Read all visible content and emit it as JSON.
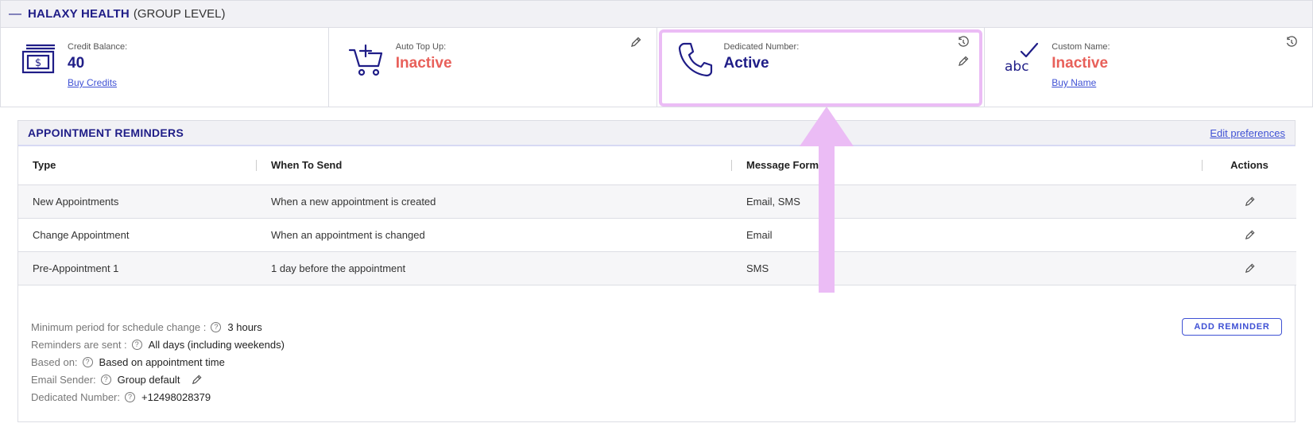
{
  "header": {
    "collapse_glyph": "—",
    "org_name": "HALAXY HEALTH",
    "level": "(GROUP LEVEL)"
  },
  "cards": {
    "credit": {
      "label": "Credit Balance:",
      "value": "40",
      "link": "Buy Credits",
      "icon": "dollar-bill-icon"
    },
    "topup": {
      "label": "Auto Top Up:",
      "value": "Inactive",
      "icon": "cart-plus-icon"
    },
    "dedicated": {
      "label": "Dedicated Number:",
      "value": "Active",
      "icon": "phone-icon"
    },
    "custom": {
      "label": "Custom Name:",
      "value": "Inactive",
      "link": "Buy Name",
      "icon": "abc-check-icon"
    }
  },
  "reminders": {
    "title": "APPOINTMENT REMINDERS",
    "edit_link": "Edit preferences",
    "columns": [
      "Type",
      "When To Send",
      "Message Format",
      "Actions"
    ],
    "rows": [
      {
        "type": "New Appointments",
        "when": "When a new appointment is created",
        "format": "Email, SMS"
      },
      {
        "type": "Change Appointment",
        "when": "When an appointment is changed",
        "format": "Email"
      },
      {
        "type": "Pre-Appointment 1",
        "when": "1 day before the appointment",
        "format": "SMS"
      }
    ],
    "settings": {
      "min_period": {
        "label": "Minimum period for schedule change :",
        "value": "3 hours"
      },
      "sent": {
        "label": "Reminders are sent :",
        "value": "All days (including weekends)"
      },
      "based": {
        "label": "Based on:",
        "value": "Based on appointment time"
      },
      "sender": {
        "label": "Email Sender:",
        "value": "Group default"
      },
      "number": {
        "label": "Dedicated Number:",
        "value": "+12498028379"
      }
    },
    "add_button": "ADD REMINDER"
  },
  "colors": {
    "brand": "#1f1d87",
    "inactive": "#e8605a",
    "link": "#3f51d4",
    "highlight": "#ebbcf5"
  }
}
